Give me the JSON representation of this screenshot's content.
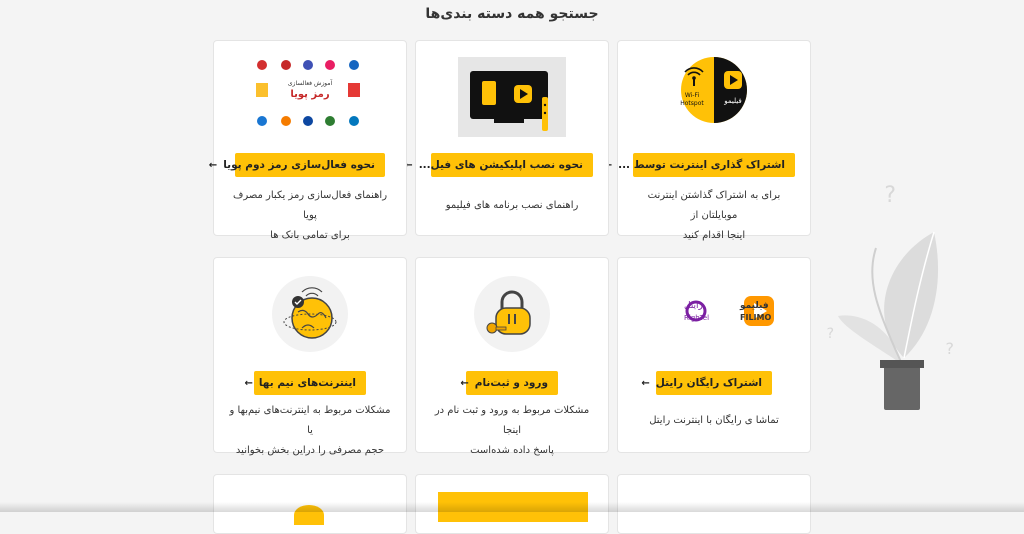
{
  "page": {
    "title": "جستجو همه دسته بندی‌ها"
  },
  "cards": [
    {
      "id": "card-1",
      "button": "اشتراک گذاری اینترنت توسط ...",
      "desc1": "برای به اشتراک گذاشتن اینترنت موبایلتان از",
      "desc2": "اینجا اقدام کنید",
      "thumb_text1": "Wi-Fi",
      "thumb_text2": "Hotspot",
      "thumb_text3": "فیلیمو"
    },
    {
      "id": "card-2",
      "button": "نحوه نصب اپلیکیشن های فیل...",
      "desc1": "راهنمای نصب برنامه های فیلیمو",
      "desc2": ""
    },
    {
      "id": "card-3",
      "button": "نحوه فعال‌سازی رمز دوم پویا",
      "desc1": "راهنمای فعال‌سازی رمز یکبار مصرف پویا",
      "desc2": "برای تمامی بانک ها",
      "thumb_text1": "آموزش فعالسازی",
      "thumb_text2": "رمز پویا"
    },
    {
      "id": "card-4",
      "button": "اشتراک رایگان رایتل",
      "desc1": "تماشا ی رایگان با اینترنت رایتل",
      "desc2": "",
      "thumb_text1": "فیلیمو",
      "thumb_text2": "FILIMO",
      "thumb_text3": "رایتل",
      "thumb_text4": "RighTel"
    },
    {
      "id": "card-5",
      "button": "ورود و ثبت‌نام",
      "desc1": "مشکلات مربوط به ورود و ثبت نام در اینجا",
      "desc2": "پاسخ داده شده‌است"
    },
    {
      "id": "card-6",
      "button": "اینترنت‌های نیم بها",
      "desc1": "مشکلات مربوط به اینترنت‌های نیم‌بها و یا",
      "desc2": "حجم مصرفی را دراین بخش بخوانید"
    }
  ],
  "arrow": "←",
  "colors": {
    "accent": "#ffc107",
    "background": "#f4f4f4"
  }
}
